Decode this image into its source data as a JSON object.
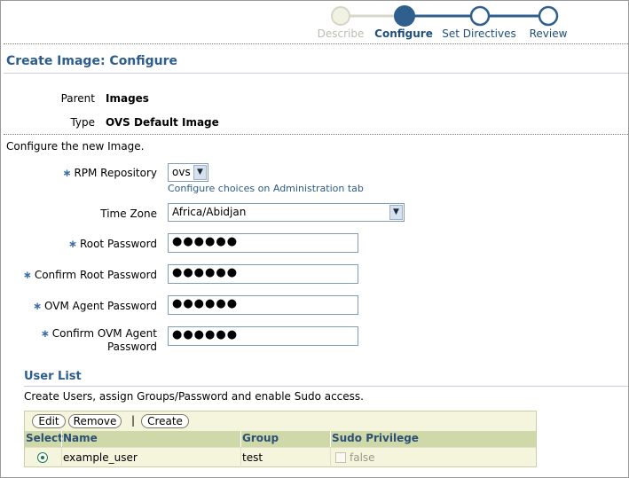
{
  "train": {
    "steps": [
      {
        "label": "Describe",
        "state": "visited"
      },
      {
        "label": "Configure",
        "state": "active"
      },
      {
        "label": "Set Directives",
        "state": "next"
      },
      {
        "label": "Review",
        "state": "next"
      }
    ]
  },
  "page": {
    "title": "Create Image: Configure",
    "parent_label": "Parent",
    "parent_value": "Images",
    "type_label": "Type",
    "type_value": "OVS Default Image",
    "instructions": "Configure the new Image."
  },
  "form": {
    "required_marker": "∗",
    "rpm_repository": {
      "label": "RPM Repository",
      "value": "ovs",
      "hint": "Configure choices on Administration tab"
    },
    "time_zone": {
      "label": "Time Zone",
      "value": "Africa/Abidjan"
    },
    "root_password": {
      "label": "Root Password",
      "value": "●●●●●●"
    },
    "confirm_root_password": {
      "label": "Confirm Root Password",
      "value": "●●●●●●"
    },
    "ovm_agent_password": {
      "label": "OVM Agent Password",
      "value": "●●●●●●"
    },
    "confirm_ovm_agent_password": {
      "label_line1": "Confirm OVM Agent",
      "label_line2": "Password",
      "value": "●●●●●●"
    }
  },
  "user_list": {
    "title": "User List",
    "description": "Create Users, assign Groups/Password and enable Sudo access.",
    "toolbar": {
      "edit": "Edit",
      "remove": "Remove",
      "separator": "|",
      "create": "Create"
    },
    "columns": [
      "Select",
      "Name",
      "Group",
      "Sudo Privilege"
    ],
    "rows": [
      {
        "selected": true,
        "name": "example_user",
        "group": "test",
        "sudo": "false"
      }
    ]
  },
  "colors": {
    "accent": "#2b5d8f",
    "train_active": "#2f5f8c",
    "train_visited": "#e8e8d8",
    "table_header": "#cfd8a8",
    "table_body": "#f5f5dd"
  }
}
